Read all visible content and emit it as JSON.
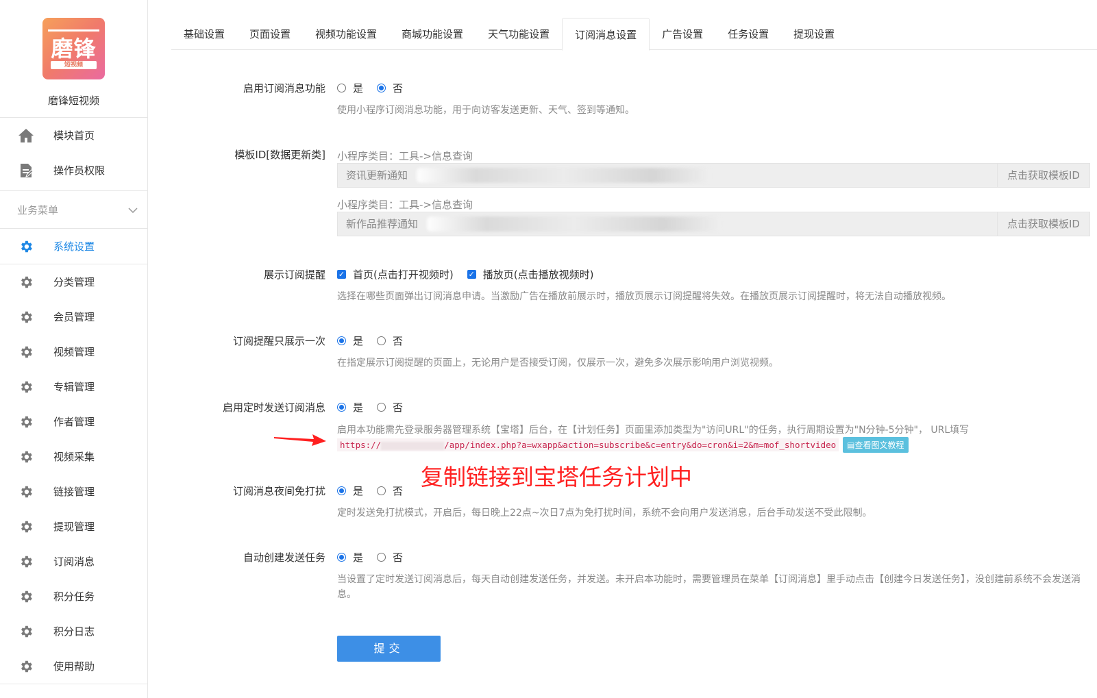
{
  "brand": {
    "logo_text": "磨锋",
    "logo_sub": "短视频",
    "name": "磨锋短视频"
  },
  "sidebar": {
    "top_items": [
      {
        "label": "模块首页",
        "icon": "home-icon"
      },
      {
        "label": "操作员权限",
        "icon": "document-edit-icon"
      }
    ],
    "group_label": "业务菜单",
    "items": [
      {
        "label": "系统设置",
        "active": true
      },
      {
        "label": "分类管理"
      },
      {
        "label": "会员管理"
      },
      {
        "label": "视频管理"
      },
      {
        "label": "专辑管理"
      },
      {
        "label": "作者管理"
      },
      {
        "label": "视频采集"
      },
      {
        "label": "链接管理"
      },
      {
        "label": "提现管理"
      },
      {
        "label": "订阅消息"
      },
      {
        "label": "积分任务"
      },
      {
        "label": "积分日志"
      },
      {
        "label": "使用帮助"
      }
    ]
  },
  "tabs": [
    "基础设置",
    "页面设置",
    "视频功能设置",
    "商城功能设置",
    "天气功能设置",
    "订阅消息设置",
    "广告设置",
    "任务设置",
    "提现设置"
  ],
  "active_tab": "订阅消息设置",
  "form": {
    "enable_subscribe": {
      "label": "启用订阅消息功能",
      "yes": "是",
      "no": "否",
      "value": "否",
      "help": "使用小程序订阅消息功能，用于向访客发送更新、天气、签到等通知。"
    },
    "template_id": {
      "label": "模板ID[数据更新类]",
      "category1": "小程序类目：工具->信息查询",
      "input1": "资讯更新通知",
      "button1": "点击获取模板ID",
      "category2": "小程序类目：工具->信息查询",
      "input2": "新作品推荐通知",
      "button2": "点击获取模板ID"
    },
    "show_reminder": {
      "label": "展示订阅提醒",
      "opt1": "首页(点击打开视频时)",
      "opt2": "播放页(点击播放视频时)",
      "help": "选择在哪些页面弹出订阅消息申请。当激励广告在播放前展示时，播放页展示订阅提醒将失效。在播放页展示订阅提醒时，将无法自动播放视频。"
    },
    "show_once": {
      "label": "订阅提醒只展示一次",
      "yes": "是",
      "no": "否",
      "value": "是",
      "help": "在指定展示订阅提醒的页面上，无论用户是否接受订阅，仅展示一次，避免多次展示影响用户浏览视频。"
    },
    "timed_send": {
      "label": "启用定时发送订阅消息",
      "yes": "是",
      "no": "否",
      "value": "是",
      "help": "启用本功能需先登录服务器管理系统【宝塔】后台，在【计划任务】页面里添加类型为\"访问URL\"的任务，执行周期设置为\"N分钟-5分钟\"， URL填写",
      "url_prefix": "https://",
      "url_suffix": "/app/index.php?a=wxapp&action=subscribe&c=entry&do=cron&i=2&m=mof_shortvideo",
      "tutorial": "查看图文教程"
    },
    "night_silent": {
      "label": "订阅消息夜间免打扰",
      "yes": "是",
      "no": "否",
      "value": "是",
      "help": "定时发送免打扰模式，开启后，每日晚上22点~次日7点为免打扰时间，系统不会向用户发送消息，后台手动发送不受此限制。"
    },
    "auto_create": {
      "label": "自动创建发送任务",
      "yes": "是",
      "no": "否",
      "value": "是",
      "help": "当设置了定时发送订阅消息后，每天自动创建发送任务，并发送。未开启本功能时，需要管理员在菜单【订阅消息】里手动点击【创建今日发送任务】，没创建前系统不会发送消息。"
    },
    "submit": "提交"
  },
  "annotation": "复制链接到宝塔任务计划中",
  "colors": {
    "accent": "#1a73e8",
    "active_nav": "#1e88e5",
    "submit_bg": "#3d8fe6",
    "annotation": "#ff2020",
    "tutorial_bg": "#5bc0de"
  }
}
